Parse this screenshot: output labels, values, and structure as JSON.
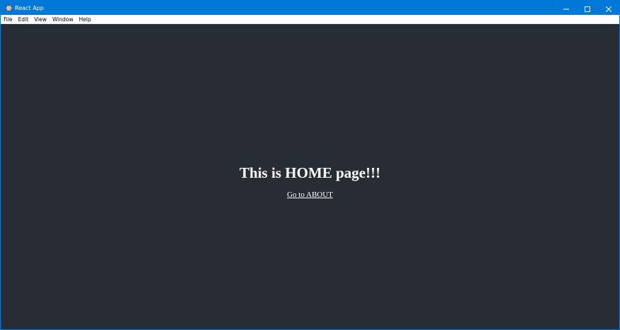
{
  "window": {
    "title": "React App",
    "titlebar_color": "#0078d7",
    "app_icon": "react-atom-icon",
    "controls": {
      "minimize_icon": "minimize-icon",
      "maximize_icon": "maximize-icon",
      "close_icon": "close-icon"
    }
  },
  "menubar": {
    "items": [
      {
        "label": "File"
      },
      {
        "label": "Edit"
      },
      {
        "label": "View"
      },
      {
        "label": "Window"
      },
      {
        "label": "Help"
      }
    ]
  },
  "page": {
    "background": "#282c34",
    "heading": "This is HOME page!!!",
    "link_label": "Go to ABOUT"
  }
}
